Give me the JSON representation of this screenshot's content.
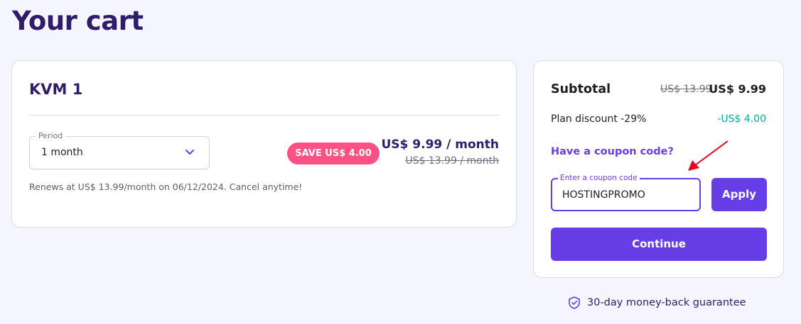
{
  "page": {
    "title": "Your cart"
  },
  "cart": {
    "plan_name": "KVM 1",
    "period": {
      "label": "Period",
      "value": "1 month"
    },
    "save_badge": "SAVE US$ 4.00",
    "price_now": "US$ 9.99 / month",
    "price_old": "US$ 13.99 / month",
    "renew_note": "Renews at US$ 13.99/month on 06/12/2024. Cancel anytime!"
  },
  "summary": {
    "subtotal_label": "Subtotal",
    "subtotal_old": "US$ 13.99",
    "subtotal_now": "US$ 9.99",
    "discount_label": "Plan discount -29%",
    "discount_value": "-US$ 4.00",
    "coupon_link": "Have a coupon code?",
    "coupon_label": "Enter a coupon code",
    "coupon_value": "HOSTINGPROMO",
    "apply_label": "Apply",
    "continue_label": "Continue"
  },
  "guarantee": {
    "text": "30-day money-back guarantee",
    "icon": "shield-check-icon"
  },
  "colors": {
    "brand": "#673de6",
    "heading": "#2f1c6a",
    "badge": "#fc5185",
    "discount": "#00b090",
    "annotation": "#e8001c"
  }
}
